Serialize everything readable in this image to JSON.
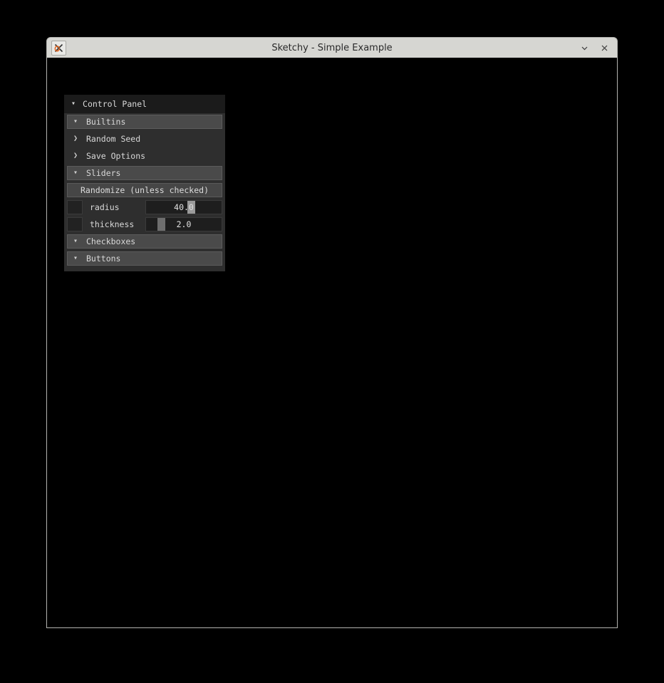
{
  "window": {
    "title": "Sketchy - Simple Example",
    "app_icon": "x-logo-icon",
    "minimize_icon": "chevron-down-icon",
    "close_icon": "close-icon",
    "titlebar_color": "#d6d6d2",
    "client_color": "#000000"
  },
  "panel": {
    "header": {
      "label": "Control Panel",
      "expanded": true,
      "chevron": "chevron-down-icon"
    },
    "accent_color": "#4a4a4a",
    "background_color": "#2e2e2e",
    "items": [
      {
        "kind": "section",
        "label": "Builtins",
        "expanded": true,
        "chevron": "chevron-down-icon",
        "filled": true
      },
      {
        "kind": "section",
        "label": "Random Seed",
        "expanded": false,
        "chevron": "chevron-right-icon",
        "filled": false
      },
      {
        "kind": "section",
        "label": "Save Options",
        "expanded": false,
        "chevron": "chevron-right-icon",
        "filled": false
      },
      {
        "kind": "section",
        "label": "Sliders",
        "expanded": true,
        "chevron": "chevron-down-icon",
        "filled": true
      },
      {
        "kind": "button",
        "label": "Randomize (unless checked)"
      },
      {
        "kind": "slider",
        "label": "radius",
        "value": "40.0",
        "fraction": 0.55,
        "checked": false,
        "handle_color": "#9a9a9a"
      },
      {
        "kind": "slider",
        "label": "thickness",
        "value": "2.0",
        "fraction": 0.15,
        "checked": false,
        "handle_color": "#6e6e6e"
      },
      {
        "kind": "section",
        "label": "Checkboxes",
        "expanded": true,
        "chevron": "chevron-down-icon",
        "filled": true
      },
      {
        "kind": "section",
        "label": "Buttons",
        "expanded": true,
        "chevron": "chevron-down-icon",
        "filled": true
      }
    ]
  }
}
